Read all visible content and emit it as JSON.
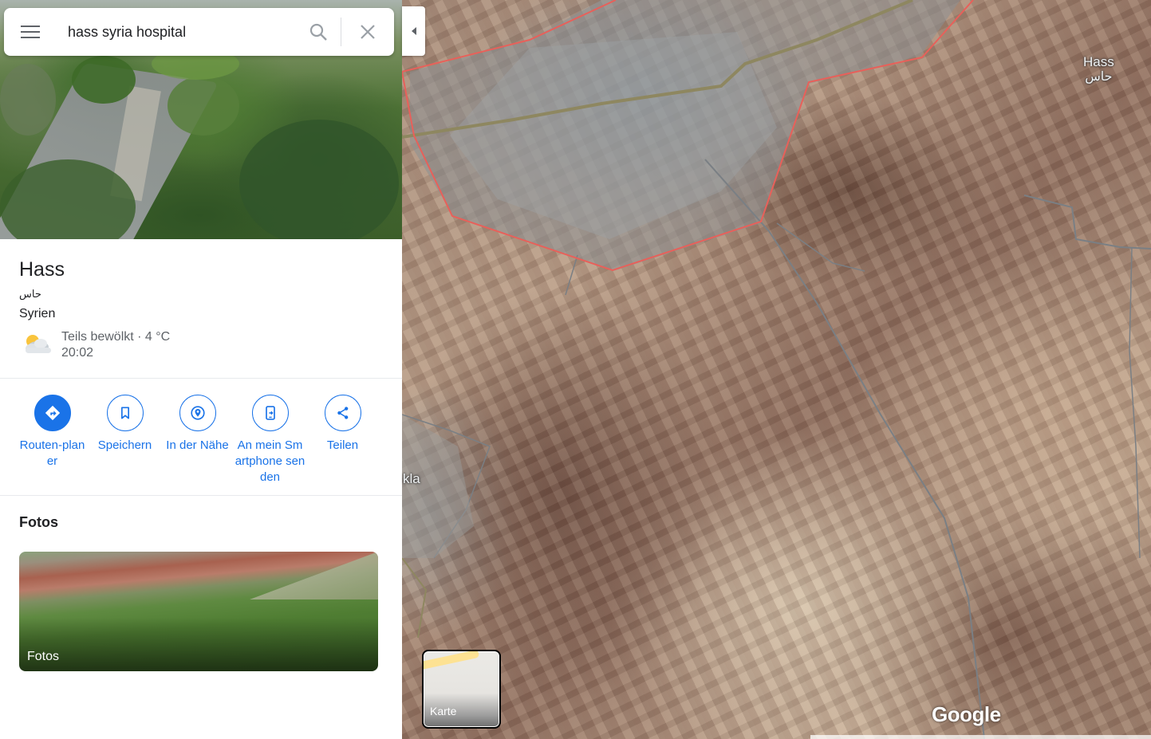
{
  "search": {
    "query": "hass syria hospital"
  },
  "place": {
    "title": "Hass",
    "arabic_name": "حاس",
    "country": "Syrien",
    "weather": {
      "condition": "Teils bewölkt · 4 °C",
      "time": "20:02",
      "icon": "partly-cloudy-icon"
    }
  },
  "actions": [
    {
      "label": "Routen-planer",
      "icon": "directions-icon"
    },
    {
      "label": "Speichern",
      "icon": "bookmark-icon"
    },
    {
      "label": "In der Nähe",
      "icon": "nearby-icon"
    },
    {
      "label": "An mein Smartphone senden",
      "icon": "send-to-phone-icon"
    },
    {
      "label": "Teilen",
      "icon": "share-icon"
    }
  ],
  "photos": {
    "title": "Fotos",
    "card_label": "Fotos"
  },
  "map": {
    "labels": {
      "hass": "Hass",
      "hass_ar": "حاس",
      "kla": "kla"
    },
    "layer_toggle_label": "Karte",
    "logo": "Google"
  },
  "colors": {
    "accent": "#1a73e8",
    "boundary": "#e8605a",
    "text_secondary": "#5f6368"
  }
}
